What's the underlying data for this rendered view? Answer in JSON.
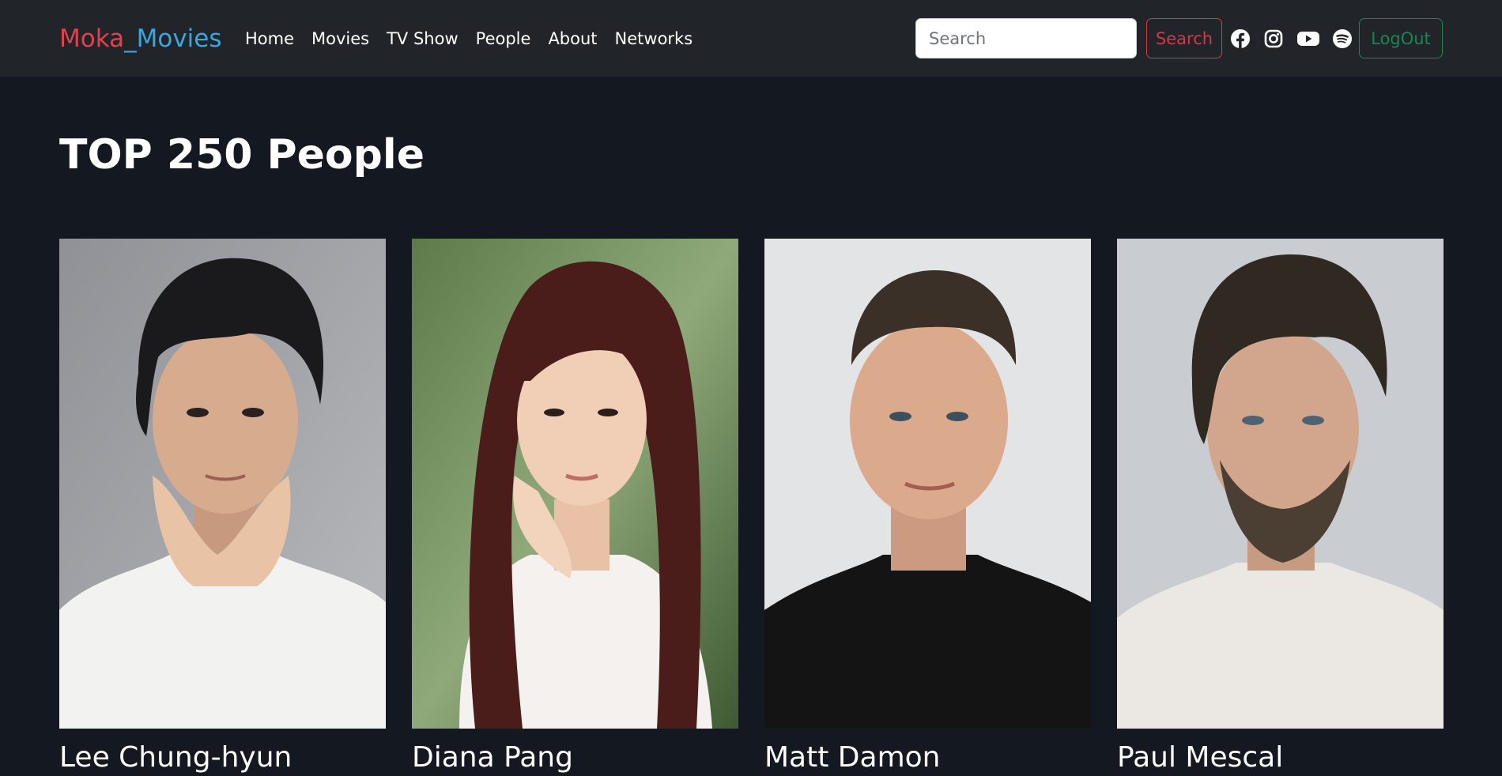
{
  "brand": {
    "part1": "Moka",
    "part2": "_Movies"
  },
  "nav": {
    "items": [
      {
        "label": "Home"
      },
      {
        "label": "Movies"
      },
      {
        "label": "TV Show"
      },
      {
        "label": "People"
      },
      {
        "label": "About"
      },
      {
        "label": "Networks"
      }
    ]
  },
  "search": {
    "placeholder": "Search",
    "value": "",
    "button_label": "Search"
  },
  "social_icons": [
    "facebook-icon",
    "instagram-icon",
    "youtube-icon",
    "spotify-icon"
  ],
  "logout_label": "LogOut",
  "colors": {
    "brand_red": "#e0424f",
    "brand_blue": "#3aa7dd",
    "search_red": "#dc3545",
    "logout_green": "#198754",
    "page_bg": "#141821",
    "navbar_bg": "#212429"
  },
  "page": {
    "title": "TOP 250 People"
  },
  "people": [
    {
      "name": "Lee Chung-hyun"
    },
    {
      "name": "Diana Pang"
    },
    {
      "name": "Matt Damon"
    },
    {
      "name": "Paul Mescal"
    }
  ]
}
